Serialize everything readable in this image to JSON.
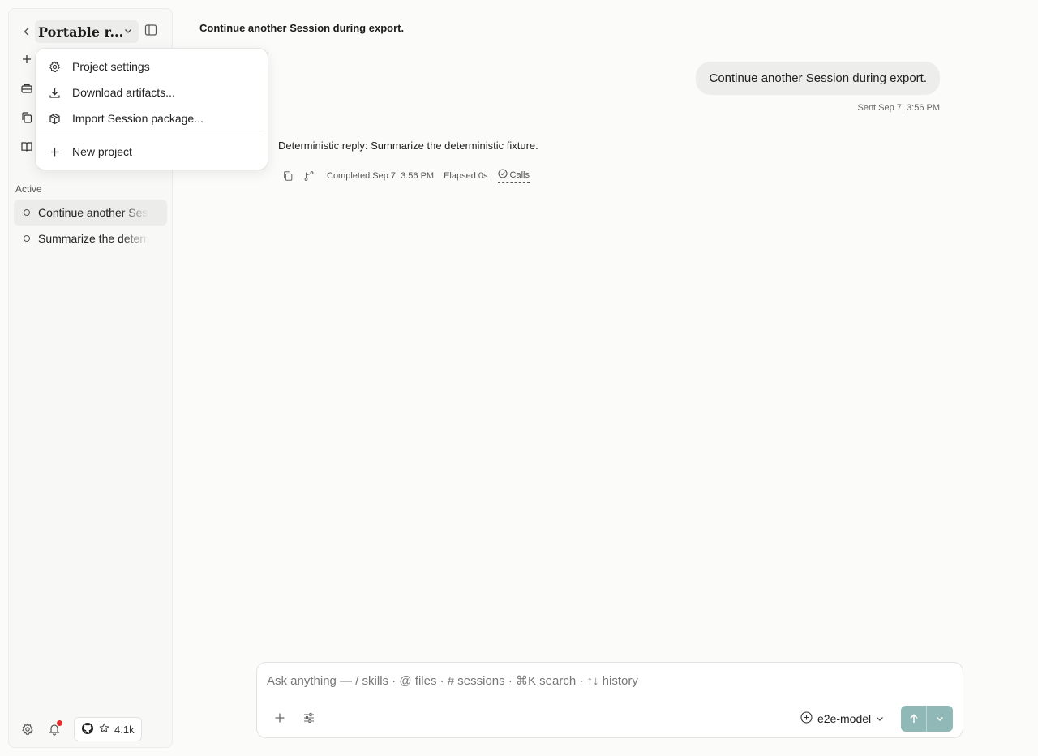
{
  "sidebar": {
    "project_name": "Portable r...",
    "section_label": "Active",
    "sessions": [
      {
        "label": "Continue another Session during export.",
        "active": true
      },
      {
        "label": "Summarize the deterministic fixture.",
        "active": false
      }
    ],
    "github_stars": "4.1k"
  },
  "project_menu": {
    "items": [
      {
        "label": "Project settings",
        "icon": "gear-icon"
      },
      {
        "label": "Download artifacts...",
        "icon": "download-icon"
      },
      {
        "label": "Import Session package...",
        "icon": "package-icon"
      },
      {
        "label": "New project",
        "icon": "plus-icon"
      }
    ]
  },
  "header": {
    "title": "Continue another Session during export."
  },
  "conversation": {
    "user_message": "Continue another Session during export.",
    "sent_time": "Sent Sep 7, 3:56 PM",
    "reply": "Deterministic reply: Summarize the deterministic fixture.",
    "completed": "Completed Sep 7, 3:56 PM",
    "elapsed": "Elapsed 0s",
    "calls_label": "Calls"
  },
  "composer": {
    "placeholder": "Ask anything — / skills · @ files · # sessions · ⌘K search · ↑↓ history",
    "model": "e2e-model"
  },
  "colors": {
    "accent": "#8fb8b6",
    "notification": "#e0302b"
  }
}
